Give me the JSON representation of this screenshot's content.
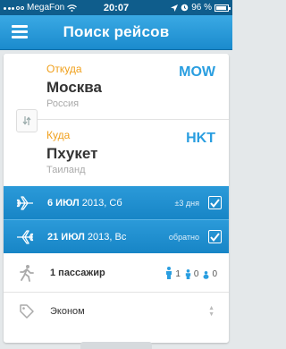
{
  "status_bar": {
    "carrier": "MegaFon",
    "time": "20:07",
    "battery": "96 %"
  },
  "header": {
    "title": "Поиск рейсов"
  },
  "origin": {
    "label": "Откуда",
    "city": "Москва",
    "country": "Россия",
    "code": "MOW"
  },
  "destination": {
    "label": "Куда",
    "city": "Пхукет",
    "country": "Таиланд",
    "code": "HKT"
  },
  "departure": {
    "date": "6 ИЮЛ",
    "year_weekday": "2013, Сб",
    "note": "±3 дня",
    "checked": true
  },
  "return": {
    "date": "21 ИЮЛ",
    "year_weekday": "2013, Вс",
    "note": "обратно",
    "checked": true
  },
  "passengers": {
    "label": "1 пассажир",
    "adults": "1",
    "children": "0",
    "infants": "0"
  },
  "cabin_class": {
    "label": "Эконом"
  },
  "colors": {
    "accent": "#2a9ee0",
    "label_orange": "#f0a01c",
    "header_blue": "#1b8bcd"
  }
}
